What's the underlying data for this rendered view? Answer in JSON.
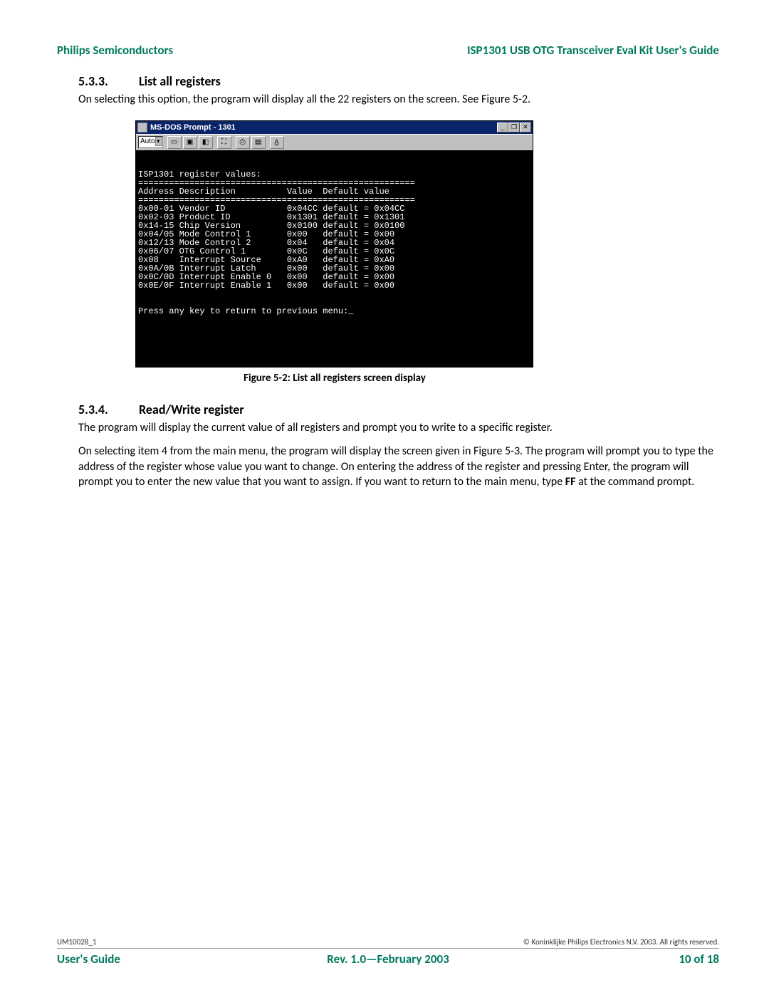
{
  "header": {
    "left": "Philips Semiconductors",
    "right": "ISP1301 USB OTG Transceiver Eval Kit User's Guide"
  },
  "section1": {
    "num": "5.3.3.",
    "title": "List all registers",
    "body": "On selecting this option, the program will display all the 22 registers on the screen. See Figure 5-2."
  },
  "doswin": {
    "title": "MS-DOS Prompt - 1301",
    "toolbar_mode": "Auto",
    "terminal": "\n\nISP1301 register values:\n======================================================\nAddress Description          Value  Default value\n======================================================\n0x00-01 Vendor ID            0x04CC default = 0x04CC\n0x02-03 Product ID           0x1301 default = 0x1301\n0x14-15 Chip Version         0x0100 default = 0x0100\n0x04/05 Mode Control 1       0x00   default = 0x00\n0x12/13 Mode Control 2       0x04   default = 0x04\n0x06/07 OTG Control 1        0x0C   default = 0x0C\n0x08    Interrupt Source     0xA0   default = 0xA0\n0x0A/0B Interrupt Latch      0x00   default = 0x00\n0x0C/0D Interrupt Enable 0   0x00   default = 0x00\n0x0E/0F Interrupt Enable 1   0x00   default = 0x00\n\n\nPress any key to return to previous menu:_"
  },
  "figure_caption": "Figure 5-2: List all registers screen display",
  "section2": {
    "num": "5.3.4.",
    "title": "Read/Write register",
    "body1": "The program will display the current value of all registers and prompt you to write to a specific register.",
    "body2_a": "On selecting item 4 from the main menu, the program will display the screen given in Figure 5-3. The program will prompt you to type the address of the register whose value you want to change. On entering the address of the register and pressing Enter, the program will prompt you to enter the new value that you want to assign. If you want to return to the main menu, type ",
    "body2_b": "FF",
    "body2_c": " at the command prompt."
  },
  "footer": {
    "docid": "UM10028_1",
    "copyright": "© Koninklijke Philips Electronics N.V. 2003. All rights reserved.",
    "left": "User's Guide",
    "center": "Rev. 1.0—February 2003",
    "right": "10 of 18"
  }
}
